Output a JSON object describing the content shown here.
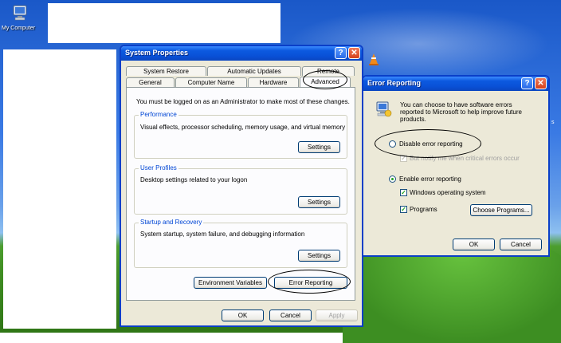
{
  "desktop": {
    "my_computer_label": "My Computer",
    "tray_fragment": "s"
  },
  "system_properties": {
    "title": "System Properties",
    "help_glyph": "?",
    "close_glyph": "✕",
    "tabs_row1": [
      "System Restore",
      "Automatic Updates",
      "Remote"
    ],
    "tabs_row2": [
      "General",
      "Computer Name",
      "Hardware",
      "Advanced"
    ],
    "admin_notice": "You must be logged on as an Administrator to make most of these changes.",
    "performance": {
      "title": "Performance",
      "desc": "Visual effects, processor scheduling, memory usage, and virtual memory",
      "button": "Settings"
    },
    "user_profiles": {
      "title": "User Profiles",
      "desc": "Desktop settings related to your logon",
      "button": "Settings"
    },
    "startup_recovery": {
      "title": "Startup and Recovery",
      "desc": "System startup, system failure, and debugging information",
      "button": "Settings"
    },
    "env_vars_button": "Environment Variables",
    "error_reporting_button": "Error Reporting",
    "ok": "OK",
    "cancel": "Cancel",
    "apply": "Apply"
  },
  "error_reporting": {
    "title": "Error Reporting",
    "help_glyph": "?",
    "close_glyph": "✕",
    "intro": [
      "You can choose to have software errors",
      "reported to Microsoft to help improve future",
      "products."
    ],
    "disable_label": "Disable error reporting",
    "notify_label": "But notify me when critical errors occur",
    "enable_label": "Enable error reporting",
    "windows_os_label": "Windows operating system",
    "programs_label": "Programs",
    "choose_programs_button": "Choose Programs...",
    "ok": "OK",
    "cancel": "Cancel",
    "check_glyph": "✓"
  }
}
